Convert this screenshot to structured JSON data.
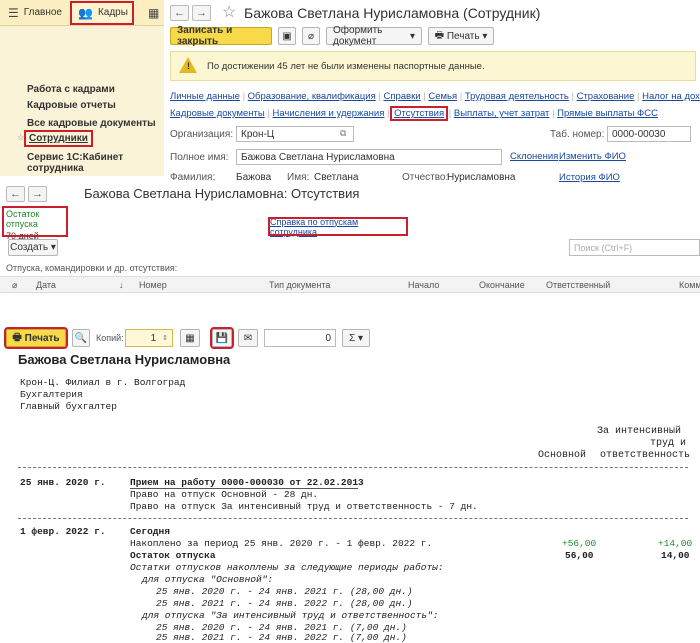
{
  "topnav": {
    "home": "Главное",
    "kadry": "Кадры"
  },
  "left_menu": [
    "Работа с кадрами",
    "Кадровые отчеты",
    "Все кадровые документы",
    "Сотрудники",
    "Сервис 1С:Кабинет сотрудника"
  ],
  "form": {
    "title": "Бажова Светлана Нурисламовна (Сотрудник)",
    "save_close": "Записать и закрыть",
    "create_doc": "Оформить документ",
    "print": "Печать",
    "warning": "По достижении 45 лет не были изменены паспортные данные.",
    "links_row1": [
      "Личные данные",
      "Образование, квалификация",
      "Справки",
      "Семья",
      "Трудовая деятельность",
      "Страхование",
      "Налог на доходы"
    ],
    "links_row2": [
      "Кадровые документы",
      "Начисления и удержания",
      "Отсутствия",
      "Выплаты, учет затрат",
      "Прямые выплаты ФСС"
    ],
    "org_label": "Организация:",
    "org_value": "Крон-Ц",
    "tab_label": "Таб. номер:",
    "tab_value": "0000-00030",
    "fullname_label": "Полное имя:",
    "fullname_value": "Бажова Светлана Нурисламовна",
    "declensions": "Склонения",
    "change_name": "Изменить ФИО",
    "surname_label": "Фамилия:",
    "surname_value": "Бажова",
    "name_label": "Имя:",
    "name_value": "Светлана",
    "patronymic_label": "Отчество:",
    "patronymic_value": "Нурисламовна",
    "history": "История ФИО"
  },
  "absences": {
    "title": "Бажова Светлана Нурисламовна: Отсутствия",
    "balance_label": "Остаток отпуска",
    "balance_value": "70 дней",
    "help_link": "Справка по отпускам сотрудника",
    "create": "Создать",
    "search_placeholder": "Поиск (Ctrl+F)",
    "list_caption": "Отпуска, командировки и др. отсутствия:",
    "columns": [
      "Дата",
      "Номер",
      "Тип документа",
      "Начало",
      "Окончание",
      "Ответственный",
      "Комм"
    ]
  },
  "print_toolbar": {
    "print": "Печать",
    "copies_label": "Копий:",
    "copies_value": "1",
    "sum_value": "0",
    "sigma": "Σ"
  },
  "report": {
    "name": "Бажова Светлана Нурисламовна",
    "org_lines": [
      "Крон-Ц. Филиал в г. Волгоград",
      "Бухгалтерия",
      "Главный бухгалтер"
    ],
    "col_basic": "Основной",
    "col_intense": [
      "За интенсивный",
      "труд и",
      "ответственность"
    ],
    "entry1": {
      "date": "25 янв. 2020 г.",
      "head": "Прием на работу 0000-000030 от 22.02.2013",
      "lines": [
        "Право на отпуск Основной - 28 дн.",
        "Право на отпуск За интенсивный труд и ответственность - 7 дн."
      ]
    },
    "entry2": {
      "date": "1 февр. 2022 г.",
      "today": "Сегодня",
      "accrued": "Накоплено за период 25 янв. 2020 г. - 1 февр. 2022 г.",
      "accrued_basic": "+56,00",
      "accrued_intense": "+14,00",
      "balance": "Остаток отпуска",
      "balance_basic": "56,00",
      "balance_intense": "14,00",
      "note": "Остатки отпусков накоплены за следующие периоды работы:",
      "basic_head": "для отпуска \"Основной\":",
      "basic_periods": [
        "25 янв. 2020 г. - 24 янв. 2021 г. (28,00 дн.)",
        "25 янв. 2021 г. - 24 янв. 2022 г. (28,00 дн.)"
      ],
      "intense_head": "для отпуска \"За интенсивный труд и ответственность\":",
      "intense_periods": [
        "25 янв. 2020 г. - 24 янв. 2021 г. (7,00 дн.)",
        "25 янв. 2021 г. - 24 янв. 2022 г. (7,00 дн.)"
      ]
    }
  }
}
